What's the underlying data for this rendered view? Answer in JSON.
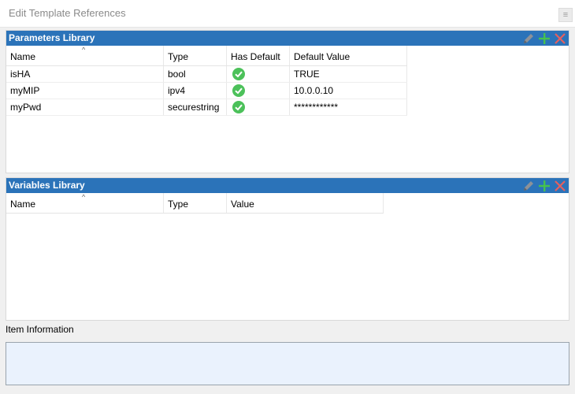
{
  "window": {
    "title": "Edit Template References"
  },
  "parameters": {
    "title": "Parameters Library",
    "columns": [
      "Name",
      "Type",
      "Has Default",
      "Default Value"
    ],
    "rows": [
      {
        "name": "isHA",
        "type": "bool",
        "has_default": true,
        "default_value": "TRUE"
      },
      {
        "name": "myMIP",
        "type": "ipv4",
        "has_default": true,
        "default_value": "10.0.0.10"
      },
      {
        "name": "myPwd",
        "type": "securestring",
        "has_default": true,
        "default_value": "************"
      }
    ]
  },
  "variables": {
    "title": "Variables Library",
    "columns": [
      "Name",
      "Type",
      "Value"
    ],
    "rows": []
  },
  "item_information": {
    "label": "Item Information",
    "text": ""
  },
  "icons": {
    "edit": "pencil-icon",
    "add": "plus-icon",
    "delete": "x-icon",
    "check": "checkmark-icon"
  },
  "colors": {
    "header_blue": "#2b73b9",
    "check_green": "#4cc15a",
    "add_green": "#45c24e",
    "delete_red": "#e4605e",
    "info_bg": "#eaf2fd"
  }
}
